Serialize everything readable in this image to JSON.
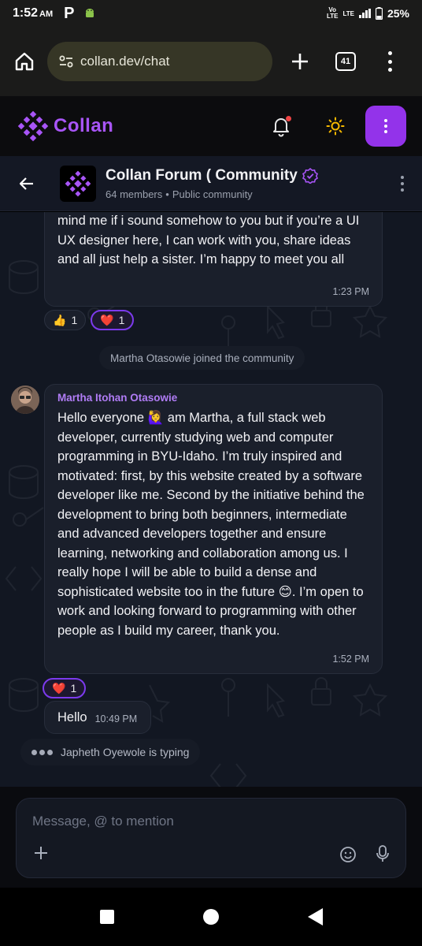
{
  "status_bar": {
    "time": "1:52",
    "ampm": "AM",
    "app_letter": "P",
    "network_top": "Vo",
    "network_bottom": "LTE",
    "network_lte": "LTE",
    "battery": "25%"
  },
  "browser": {
    "url": "collan.dev/chat",
    "tab_count": "41"
  },
  "app": {
    "brand": "Collan",
    "accent": "#9333ea"
  },
  "chat": {
    "title": "Collan Forum ( Community",
    "members": "64 members",
    "visibility": "Public community"
  },
  "messages": [
    {
      "text": "mind me if i sound somehow to you but if you’re a UI UX designer here, I can work with you, share ideas and all just help a sister.  I’m happy to meet you all",
      "time": "1:23 PM",
      "reactions": [
        {
          "emoji": "👍",
          "count": "1",
          "active": false
        },
        {
          "emoji": "❤️",
          "count": "1",
          "active": true
        }
      ]
    },
    {
      "author": "Martha Itohan Otasowie",
      "text": "Hello everyone 🙋‍♀️ am Martha, a full stack web developer, currently studying web and computer programming in BYU-Idaho. I’m truly inspired and motivated: first, by this website created by a software developer like me. Second by the initiative behind the development to bring both beginners, intermediate and advanced developers together and ensure learning, networking and collaboration among us. I really hope I will be able to build a dense and sophisticated website too in the future 😊. I’m open to work and looking forward to programming with other people as I build my career, thank you.",
      "time": "1:52 PM",
      "reactions": [
        {
          "emoji": "❤️",
          "count": "1",
          "active": true
        }
      ]
    },
    {
      "text": "Hello",
      "time": "10:49 PM"
    }
  ],
  "system_message": "Martha Otasowie joined the community",
  "typing_indicator": "Japheth Oyewole is typing",
  "composer": {
    "placeholder": "Message, @ to mention"
  }
}
